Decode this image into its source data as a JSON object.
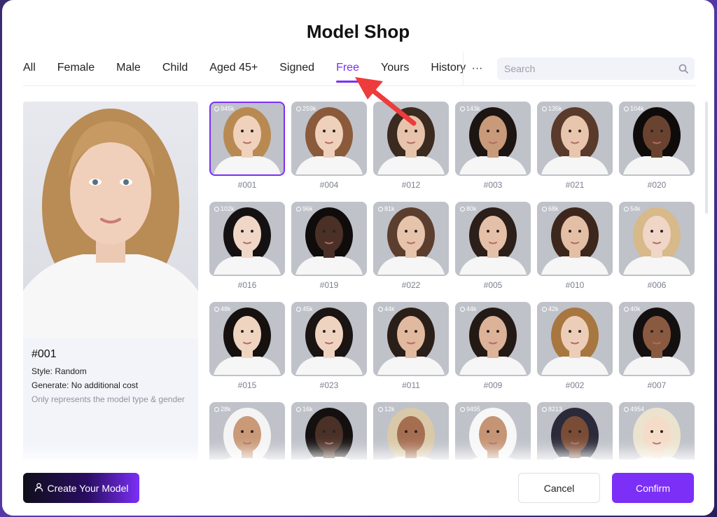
{
  "title": "Model Shop",
  "tabs": [
    {
      "label": "All",
      "active": false
    },
    {
      "label": "Female",
      "active": false
    },
    {
      "label": "Male",
      "active": false
    },
    {
      "label": "Child",
      "active": false
    },
    {
      "label": "Aged 45+",
      "active": false
    },
    {
      "label": "Signed",
      "active": false
    },
    {
      "label": "Free",
      "active": true
    },
    {
      "label": "Yours",
      "active": false
    },
    {
      "label": "History",
      "active": false
    }
  ],
  "more_label": "···",
  "search": {
    "placeholder": "Search",
    "value": ""
  },
  "preview": {
    "id": "#001",
    "style": "Style: Random",
    "generate": "Generate: No additional cost",
    "note": "Only represents the model type & gender"
  },
  "models": [
    {
      "id": "#001",
      "count": "945k",
      "selected": true,
      "skin": "#f0d2bc",
      "hair": "#b88a52"
    },
    {
      "id": "#004",
      "count": "259k",
      "selected": false,
      "skin": "#efd0bb",
      "hair": "#8a5a3a"
    },
    {
      "id": "#012",
      "count": "",
      "selected": false,
      "skin": "#e6c3aa",
      "hair": "#3b2a20"
    },
    {
      "id": "#003",
      "count": "143k",
      "selected": false,
      "skin": "#c89a7a",
      "hair": "#1c1512"
    },
    {
      "id": "#021",
      "count": "135k",
      "selected": false,
      "skin": "#e8c5ad",
      "hair": "#5a3a2a"
    },
    {
      "id": "#020",
      "count": "104k",
      "selected": false,
      "skin": "#6a4330",
      "hair": "#0f0b0a"
    },
    {
      "id": "#016",
      "count": "102k",
      "selected": false,
      "skin": "#f0d6c6",
      "hair": "#151113"
    },
    {
      "id": "#019",
      "count": "96k",
      "selected": false,
      "skin": "#4a3026",
      "hair": "#100c0b"
    },
    {
      "id": "#022",
      "count": "81k",
      "selected": false,
      "skin": "#e6c3ab",
      "hair": "#5b3e2e"
    },
    {
      "id": "#005",
      "count": "80k",
      "selected": false,
      "skin": "#e4c0a8",
      "hair": "#2c1f1a"
    },
    {
      "id": "#010",
      "count": "68k",
      "selected": false,
      "skin": "#e3bfa6",
      "hair": "#3d271d"
    },
    {
      "id": "#006",
      "count": "54k",
      "selected": false,
      "skin": "#f0d6c6",
      "hair": "#d7b98a"
    },
    {
      "id": "#015",
      "count": "48k",
      "selected": false,
      "skin": "#efd4c0",
      "hair": "#16110f"
    },
    {
      "id": "#023",
      "count": "45k",
      "selected": false,
      "skin": "#efd3c1",
      "hair": "#1a1412"
    },
    {
      "id": "#011",
      "count": "44k",
      "selected": false,
      "skin": "#e0b99f",
      "hair": "#2a1e18"
    },
    {
      "id": "#009",
      "count": "44k",
      "selected": false,
      "skin": "#dcb298",
      "hair": "#241a15"
    },
    {
      "id": "#002",
      "count": "42k",
      "selected": false,
      "skin": "#ecceb8",
      "hair": "#a8763f"
    },
    {
      "id": "#007",
      "count": "40k",
      "selected": false,
      "skin": "#8a5a40",
      "hair": "#141010"
    },
    {
      "id": "",
      "count": "28k",
      "selected": false,
      "skin": "#c99978",
      "hair": "#f4f4f4"
    },
    {
      "id": "",
      "count": "16k",
      "selected": false,
      "skin": "#4a3026",
      "hair": "#141010"
    },
    {
      "id": "",
      "count": "12k",
      "selected": false,
      "skin": "#a56e50",
      "hair": "#d9c9a8"
    },
    {
      "id": "",
      "count": "9495",
      "selected": false,
      "skin": "#c49474",
      "hair": "#f7f7f7"
    },
    {
      "id": "",
      "count": "8213",
      "selected": false,
      "skin": "#7a4c36",
      "hair": "#2a2a3a"
    },
    {
      "id": "",
      "count": "4954",
      "selected": false,
      "skin": "#f4dcc8",
      "hair": "#ece3cf"
    }
  ],
  "footer": {
    "create_label": "Create Your Model",
    "cancel_label": "Cancel",
    "confirm_label": "Confirm"
  },
  "colors": {
    "accent": "#7b2ff7",
    "arrow": "#ee3b3b"
  }
}
